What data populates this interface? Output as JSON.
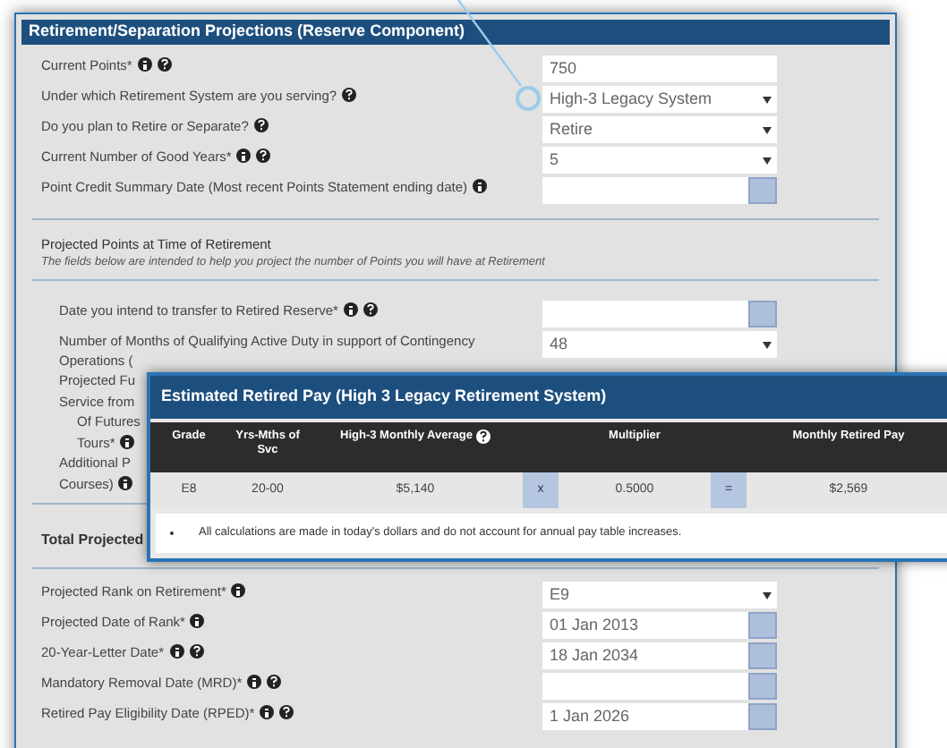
{
  "panel": {
    "title": "Retirement/Separation Projections (Reserve Component)",
    "rows": [
      {
        "label": "Current Points*",
        "info": true,
        "help": true,
        "field": {
          "kind": "text",
          "value": "750"
        }
      },
      {
        "label": "Under which Retirement System are you serving?",
        "info": false,
        "help": true,
        "field": {
          "kind": "select",
          "value": "High-3 Legacy System"
        }
      },
      {
        "label": "Do you plan to Retire or Separate?",
        "info": false,
        "help": true,
        "field": {
          "kind": "select",
          "value": "Retire"
        }
      },
      {
        "label": "Current Number of Good Years*",
        "info": true,
        "help": true,
        "field": {
          "kind": "select",
          "value": "5"
        }
      },
      {
        "label": "Point Credit Summary Date (Most recent Points Statement ending date)",
        "info": true,
        "help": false,
        "field": {
          "kind": "date"
        }
      }
    ]
  },
  "projected_points": {
    "heading": "Projected Points at Time of Retirement",
    "note": "The fields below are intended to help you project the number of Points you will have at Retirement",
    "rows": [
      {
        "label_lines": [
          "Date you intend to transfer to Retired Reserve*"
        ],
        "info": true,
        "help": true,
        "field": {
          "kind": "date"
        }
      },
      {
        "label_lines": [
          "Number of Months of Qualifying Active Duty in support of Contingency",
          "Operations ("
        ],
        "info": false,
        "help": false,
        "field": {
          "kind": "select",
          "value": "48"
        }
      }
    ],
    "covered_lines": [
      {
        "kind": "line",
        "text": "Projected Fu",
        "info": false
      },
      {
        "kind": "line",
        "text": "Service from",
        "info": false
      },
      {
        "kind": "subline",
        "text": "Of Futures",
        "info": false
      },
      {
        "kind": "subline",
        "text": "Tours*",
        "info": true
      },
      {
        "kind": "line",
        "text": "Additional P",
        "info": false
      },
      {
        "kind": "line",
        "text": "Courses)",
        "info": true
      }
    ],
    "total_label": "Total Projected"
  },
  "rank_rows": [
    {
      "label": "Projected Rank on Retirement*",
      "info": true,
      "help": false,
      "field": {
        "kind": "select",
        "value": "E9"
      }
    },
    {
      "label": "Projected Date of Rank*",
      "info": true,
      "help": false,
      "field": {
        "kind": "date",
        "value": "01 Jan 2013"
      }
    },
    {
      "label": "20-Year-Letter Date*",
      "info": true,
      "help": true,
      "field": {
        "kind": "date",
        "value": "18 Jan 2034"
      }
    },
    {
      "label": "Mandatory Removal Date (MRD)*",
      "info": true,
      "help": true,
      "field": {
        "kind": "date"
      }
    },
    {
      "label": "Retired Pay Eligibility Date (RPED)*",
      "info": true,
      "help": true,
      "field": {
        "kind": "date",
        "value": "1 Jan 2026"
      }
    }
  ],
  "popup": {
    "title": "Estimated Retired Pay (High 3 Legacy Retirement System)",
    "columns": [
      {
        "label": "Grade",
        "help": false
      },
      {
        "label": "Yrs-Mths of Svc",
        "help": false
      },
      {
        "label": "High-3 Monthly Average",
        "help": true
      },
      {
        "label": "Multiplier",
        "help": false
      },
      {
        "label": "Monthly Retired Pay",
        "help": false
      }
    ],
    "row": [
      {
        "kind": "value",
        "text": "E8"
      },
      {
        "kind": "value",
        "text": "20-00"
      },
      {
        "kind": "value",
        "text": "$5,140"
      },
      {
        "kind": "operator",
        "text": "x"
      },
      {
        "kind": "value",
        "text": "0.5000"
      },
      {
        "kind": "operator",
        "text": "="
      },
      {
        "kind": "value",
        "text": "$2,569"
      }
    ],
    "notes": [
      "All calculations are made in today's dollars and do not account for annual pay table increases."
    ]
  }
}
